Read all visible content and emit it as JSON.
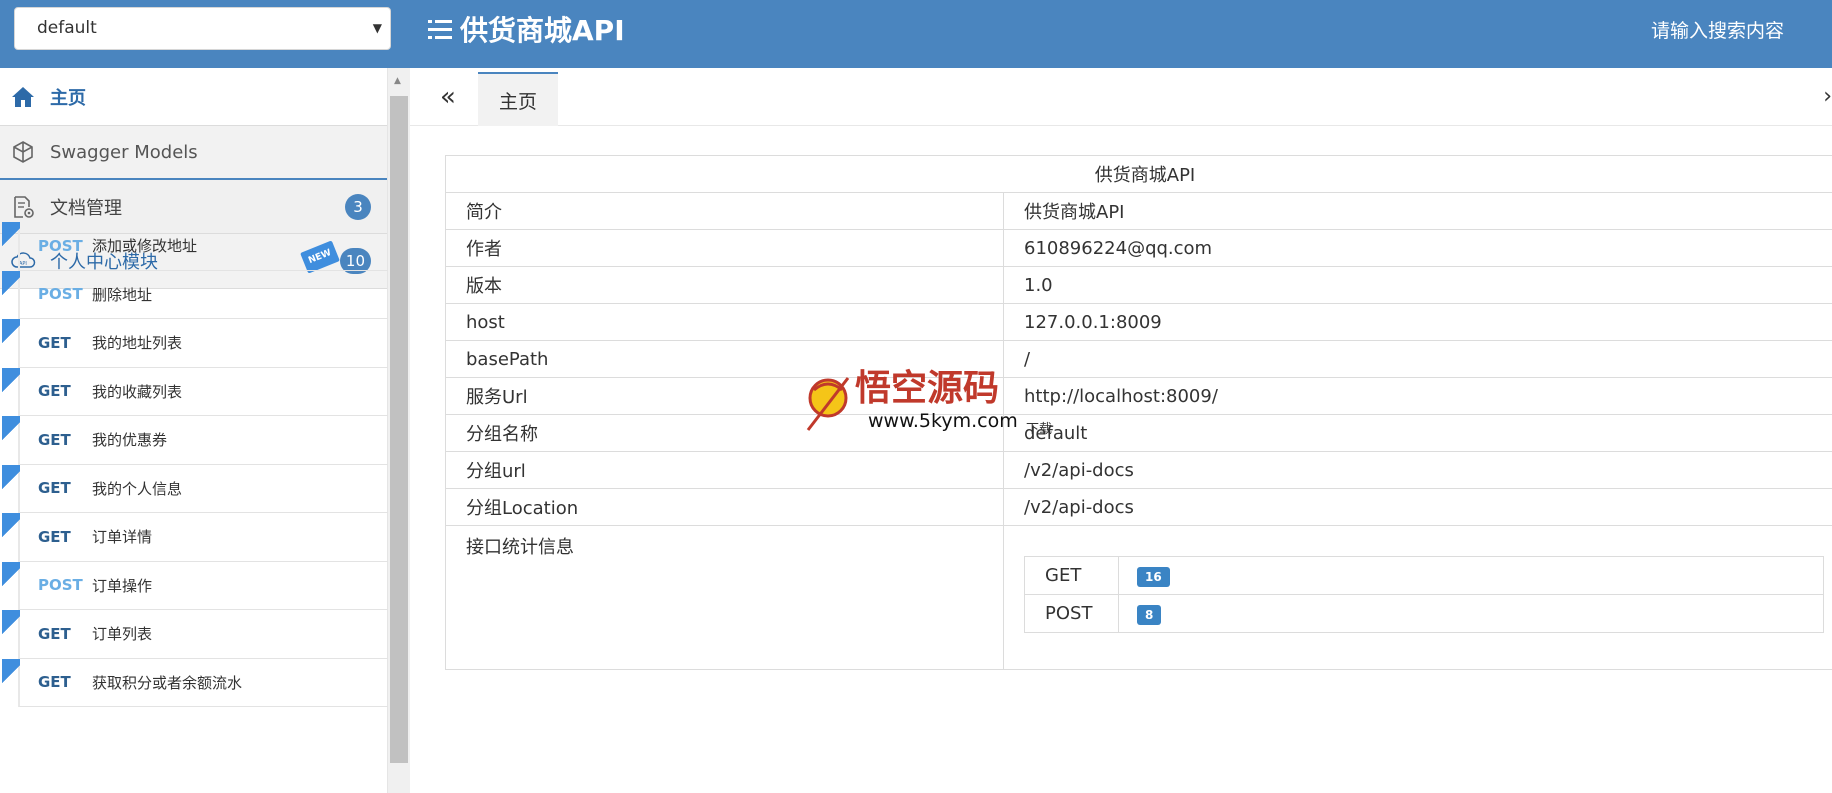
{
  "header": {
    "group_select_value": "default",
    "title": "供货商城API",
    "search_placeholder": "请输入搜索内容"
  },
  "sidebar": {
    "home_label": "主页",
    "models_label": "Swagger Models",
    "docs_label": "文档管理",
    "docs_badge": "3",
    "personal_label": "个人中心模块",
    "personal_badge": "10",
    "new_tag": "NEW",
    "apis": [
      {
        "method": "POST",
        "name": "添加或修改地址"
      },
      {
        "method": "POST",
        "name": "删除地址"
      },
      {
        "method": "GET",
        "name": "我的地址列表"
      },
      {
        "method": "GET",
        "name": "我的收藏列表"
      },
      {
        "method": "GET",
        "name": "我的优惠券"
      },
      {
        "method": "GET",
        "name": "我的个人信息"
      },
      {
        "method": "GET",
        "name": "订单详情"
      },
      {
        "method": "POST",
        "name": "订单操作"
      },
      {
        "method": "GET",
        "name": "订单列表"
      },
      {
        "method": "GET",
        "name": "获取积分或者余额流水"
      }
    ]
  },
  "tabs": {
    "home_label": "主页"
  },
  "info": {
    "caption": "供货商城API",
    "rows": [
      {
        "key": "简介",
        "value": "供货商城API"
      },
      {
        "key": "作者",
        "value": "610896224@qq.com"
      },
      {
        "key": "版本",
        "value": "1.0"
      },
      {
        "key": "host",
        "value": "127.0.0.1:8009"
      },
      {
        "key": "basePath",
        "value": "/"
      },
      {
        "key": "服务Url",
        "value": "http://localhost:8009/"
      },
      {
        "key": "分组名称",
        "value": "default"
      },
      {
        "key": "分组url",
        "value": "/v2/api-docs"
      },
      {
        "key": "分组Location",
        "value": "/v2/api-docs"
      }
    ],
    "stats_label": "接口统计信息",
    "stats": [
      {
        "method": "GET",
        "count": "16"
      },
      {
        "method": "POST",
        "count": "8"
      }
    ]
  },
  "watermark": {
    "text_cn": "悟空源码",
    "text_url": "www.5kym.com",
    "text_download": "下载"
  },
  "colors": {
    "header_bg": "#4a85bf",
    "accent": "#3a84c4",
    "post": "#6aaee4",
    "get": "#2d5f8f"
  }
}
